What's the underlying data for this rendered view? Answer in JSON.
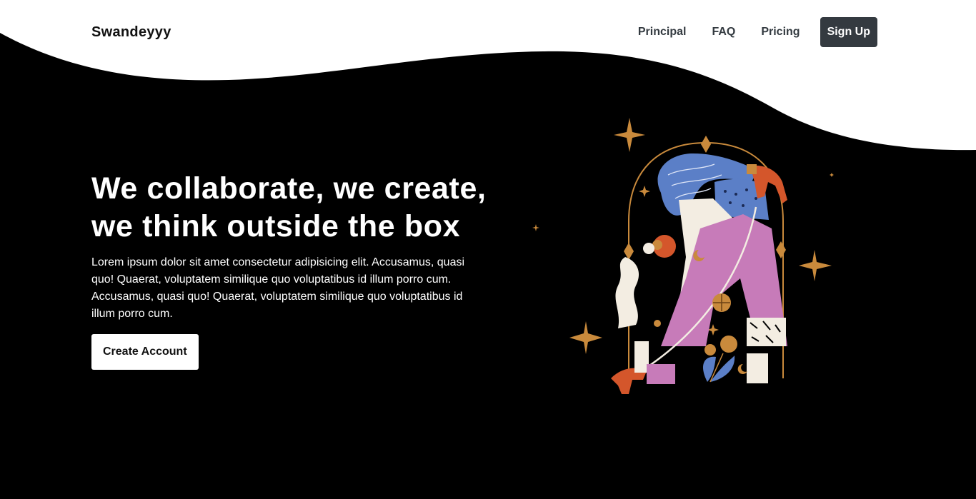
{
  "brand": "Swandeyyy",
  "nav": {
    "items": [
      {
        "label": "Principal"
      },
      {
        "label": "FAQ"
      },
      {
        "label": "Pricing"
      }
    ],
    "signup_label": "Sign Up"
  },
  "hero": {
    "title": "We collaborate, we create, we think outside the box",
    "body": "Lorem ipsum dolor sit amet consectetur adipisicing elit. Accusamus, quasi quo! Quaerat, voluptatem similique quo voluptatibus id illum porro cum. Accusamus, quasi quo! Quaerat, voluptatem similique quo voluptatibus id illum porro cum.",
    "cta_label": "Create Account"
  },
  "illustration": {
    "icon": "woman-arch-illustration",
    "colors": {
      "blue": "#5b7fc7",
      "pink": "#c77bb9",
      "orange": "#d4562b",
      "gold": "#c98a3c",
      "cream": "#f3ede2"
    }
  },
  "colors": {
    "background": "#000000",
    "header": "#ffffff",
    "button_dark": "#343a40"
  }
}
